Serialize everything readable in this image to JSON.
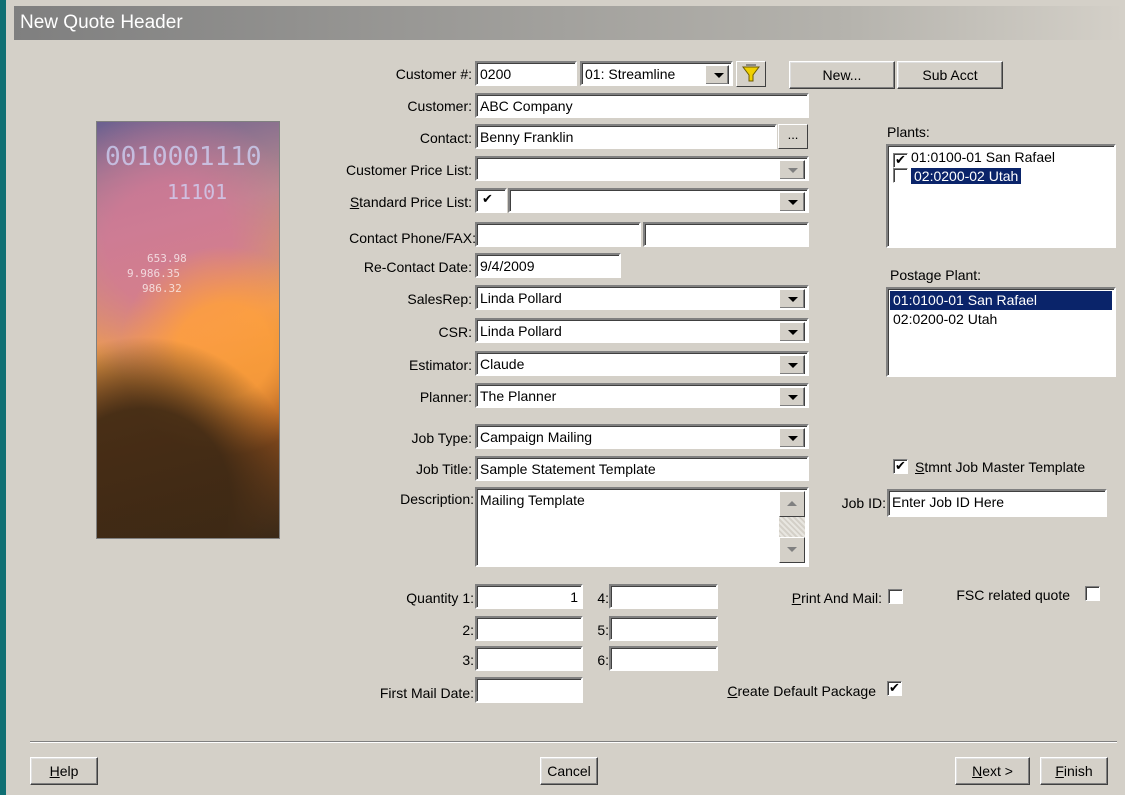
{
  "window": {
    "title": "New Quote Header"
  },
  "form": {
    "customer_num": {
      "label": "Customer #:",
      "value": "0200",
      "account": "01: Streamline"
    },
    "new_button": "New...",
    "sub_acct_button": "Sub Acct",
    "customer": {
      "label": "Customer:",
      "value": "ABC Company"
    },
    "contact": {
      "label": "Contact:",
      "value": "Benny Franklin",
      "browse": "..."
    },
    "customer_price_list": {
      "label": "Customer Price List:",
      "value": ""
    },
    "standard_price_list": {
      "label_pre": "",
      "label_u": "S",
      "label_post": "tandard Price List:",
      "checked": true,
      "value": ""
    },
    "contact_phone_fax": {
      "label": "Contact Phone/FAX:",
      "phone": "",
      "fax": ""
    },
    "recontact_date": {
      "label": "Re-Contact Date:",
      "value": "9/4/2009"
    },
    "salesrep": {
      "label": "SalesRep:",
      "value": "Linda Pollard"
    },
    "csr": {
      "label": "CSR:",
      "value": "Linda Pollard"
    },
    "estimator": {
      "label": "Estimator:",
      "value": "Claude"
    },
    "planner": {
      "label": "Planner:",
      "value": "The Planner"
    },
    "job_type": {
      "label": "Job Type:",
      "value": "Campaign Mailing"
    },
    "job_title": {
      "label": "Job Title:",
      "value": "Sample Statement Template"
    },
    "description": {
      "label": "Description:",
      "value": "Mailing Template"
    },
    "job_id": {
      "label": "Job ID:",
      "value": "Enter Job ID Here"
    },
    "stmnt_template": {
      "label_u": "S",
      "label_post": "tmnt Job Master Template",
      "checked": true
    },
    "quantities": {
      "q1_label": "Quantity 1:",
      "q1": "1",
      "q2_label": "2:",
      "q2": "",
      "q3_label": "3:",
      "q3": "",
      "q4_label": "4:",
      "q4": "",
      "q5_label": "5:",
      "q5": "",
      "q6_label": "6:",
      "q6": ""
    },
    "first_mail_date": {
      "label": "First Mail Date:",
      "value": ""
    },
    "print_and_mail": {
      "label_u": "P",
      "label_post": "rint And Mail:",
      "checked": false
    },
    "fsc_related_quote": {
      "label": "FSC related quote",
      "checked": false
    },
    "create_default_package": {
      "label_u": "C",
      "label_post": "reate Default Package",
      "checked": true
    }
  },
  "plants": {
    "label": "Plants:",
    "items": [
      {
        "text": "01:0100-01 San Rafael",
        "checked": true,
        "selected": false
      },
      {
        "text": "02:0200-02  Utah",
        "checked": false,
        "selected": true
      }
    ]
  },
  "postage_plant": {
    "label": "Postage Plant:",
    "items": [
      {
        "text": "01:0100-01 San Rafael",
        "selected": true
      },
      {
        "text": "02:0200-02  Utah",
        "selected": false
      }
    ]
  },
  "footer": {
    "help_u": "H",
    "help_post": "elp",
    "cancel": "Cancel",
    "next_u": "N",
    "next_post": "ext >",
    "finish_u": "F",
    "finish_post": "inish"
  },
  "image_digits": [
    "0010001110",
    "11101",
    "653.98",
    "9.986.35",
    "986.32"
  ],
  "colors": {
    "selection": "#0a246a",
    "dialog_bg": "#d4d0c8",
    "accent_stripe": "#0f6f73"
  }
}
